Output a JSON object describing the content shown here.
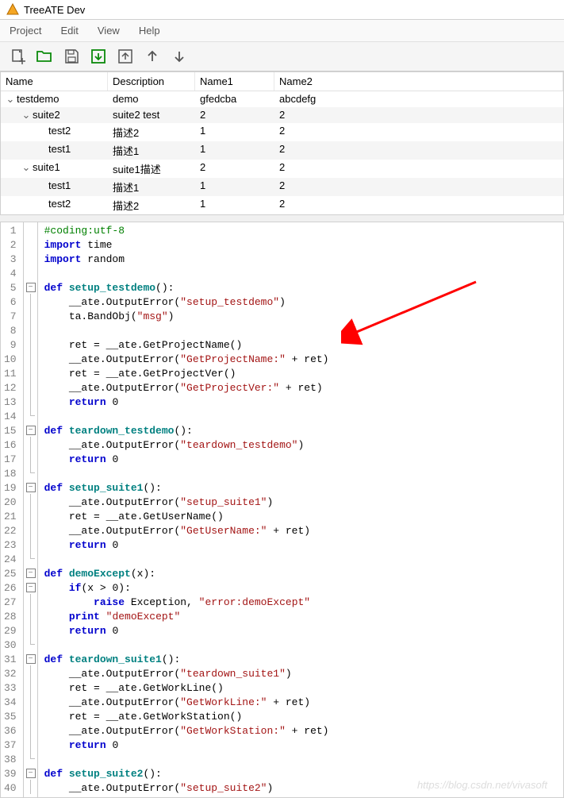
{
  "title": "TreeATE Dev",
  "menu": {
    "project": "Project",
    "edit": "Edit",
    "view": "View",
    "help": "Help"
  },
  "treeHeader": {
    "name": "Name",
    "desc": "Description",
    "n1": "Name1",
    "n2": "Name2"
  },
  "treeRows": [
    {
      "indent": 0,
      "exp": "⌄",
      "name": "testdemo",
      "desc": "demo",
      "n1": "gfedcba",
      "n2": "abcdefg"
    },
    {
      "indent": 1,
      "exp": "⌄",
      "name": "suite2",
      "desc": "suite2 test",
      "n1": "2",
      "n2": "2"
    },
    {
      "indent": 2,
      "exp": "",
      "name": "test2",
      "desc": "描述2",
      "n1": "1",
      "n2": "2"
    },
    {
      "indent": 2,
      "exp": "",
      "name": "test1",
      "desc": "描述1",
      "n1": "1",
      "n2": "2"
    },
    {
      "indent": 1,
      "exp": "⌄",
      "name": "suite1",
      "desc": "suite1描述",
      "n1": "2",
      "n2": "2"
    },
    {
      "indent": 2,
      "exp": "",
      "name": "test1",
      "desc": "描述1",
      "n1": "1",
      "n2": "2"
    },
    {
      "indent": 2,
      "exp": "",
      "name": "test2",
      "desc": "描述2",
      "n1": "1",
      "n2": "2"
    }
  ],
  "code": [
    {
      "n": 1,
      "f": "",
      "h": "<span class='cm'>#coding:utf-8</span>"
    },
    {
      "n": 2,
      "f": "",
      "h": "<span class='kw'>import</span> time"
    },
    {
      "n": 3,
      "f": "",
      "h": "<span class='kw'>import</span> random"
    },
    {
      "n": 4,
      "f": "",
      "h": ""
    },
    {
      "n": 5,
      "f": "minus",
      "h": "<span class='kw'>def</span> <span class='fn'>setup_testdemo</span>():"
    },
    {
      "n": 6,
      "f": "line",
      "h": "    __ate.OutputError(<span class='str'>\"setup_testdemo\"</span>)"
    },
    {
      "n": 7,
      "f": "line",
      "h": "    ta.BandObj(<span class='str'>\"msg\"</span>)"
    },
    {
      "n": 8,
      "f": "line",
      "h": ""
    },
    {
      "n": 9,
      "f": "line",
      "h": "    ret = __ate.GetProjectName()"
    },
    {
      "n": 10,
      "f": "line",
      "h": "    __ate.OutputError(<span class='str'>\"GetProjectName:\"</span> + ret)"
    },
    {
      "n": 11,
      "f": "line",
      "h": "    ret = __ate.GetProjectVer()"
    },
    {
      "n": 12,
      "f": "line",
      "h": "    __ate.OutputError(<span class='str'>\"GetProjectVer:\"</span> + ret)"
    },
    {
      "n": 13,
      "f": "line",
      "h": "    <span class='kw'>return</span> <span class='num'>0</span>"
    },
    {
      "n": 14,
      "f": "end",
      "h": ""
    },
    {
      "n": 15,
      "f": "minus",
      "h": "<span class='kw'>def</span> <span class='fn'>teardown_testdemo</span>():"
    },
    {
      "n": 16,
      "f": "line",
      "h": "    __ate.OutputError(<span class='str'>\"teardown_testdemo\"</span>)"
    },
    {
      "n": 17,
      "f": "line",
      "h": "    <span class='kw'>return</span> <span class='num'>0</span>"
    },
    {
      "n": 18,
      "f": "end",
      "h": ""
    },
    {
      "n": 19,
      "f": "minus",
      "h": "<span class='kw'>def</span> <span class='fn'>setup_suite1</span>():"
    },
    {
      "n": 20,
      "f": "line",
      "h": "    __ate.OutputError(<span class='str'>\"setup_suite1\"</span>)"
    },
    {
      "n": 21,
      "f": "line",
      "h": "    ret = __ate.GetUserName()"
    },
    {
      "n": 22,
      "f": "line",
      "h": "    __ate.OutputError(<span class='str'>\"GetUserName:\"</span> + ret)"
    },
    {
      "n": 23,
      "f": "line",
      "h": "    <span class='kw'>return</span> <span class='num'>0</span>"
    },
    {
      "n": 24,
      "f": "end",
      "h": ""
    },
    {
      "n": 25,
      "f": "minus",
      "h": "<span class='kw'>def</span> <span class='fn'>demoExcept</span>(x):"
    },
    {
      "n": 26,
      "f": "minus",
      "h": "    <span class='kw'>if</span>(x &gt; <span class='num'>0</span>):"
    },
    {
      "n": 27,
      "f": "line",
      "h": "        <span class='kw'>raise</span> Exception, <span class='str'>\"error:demoExcept\"</span>"
    },
    {
      "n": 28,
      "f": "line",
      "h": "    <span class='kw'>print</span> <span class='str'>\"demoExcept\"</span>"
    },
    {
      "n": 29,
      "f": "line",
      "h": "    <span class='kw'>return</span> <span class='num'>0</span>"
    },
    {
      "n": 30,
      "f": "end",
      "h": ""
    },
    {
      "n": 31,
      "f": "minus",
      "h": "<span class='kw'>def</span> <span class='fn'>teardown_suite1</span>():"
    },
    {
      "n": 32,
      "f": "line",
      "h": "    __ate.OutputError(<span class='str'>\"teardown_suite1\"</span>)"
    },
    {
      "n": 33,
      "f": "line",
      "h": "    ret = __ate.GetWorkLine()"
    },
    {
      "n": 34,
      "f": "line",
      "h": "    __ate.OutputError(<span class='str'>\"GetWorkLine:\"</span> + ret)"
    },
    {
      "n": 35,
      "f": "line",
      "h": "    ret = __ate.GetWorkStation()"
    },
    {
      "n": 36,
      "f": "line",
      "h": "    __ate.OutputError(<span class='str'>\"GetWorkStation:\"</span> + ret)"
    },
    {
      "n": 37,
      "f": "line",
      "h": "    <span class='kw'>return</span> <span class='num'>0</span>"
    },
    {
      "n": 38,
      "f": "end",
      "h": ""
    },
    {
      "n": 39,
      "f": "minus",
      "h": "<span class='kw'>def</span> <span class='fn'>setup_suite2</span>():"
    },
    {
      "n": 40,
      "f": "line",
      "h": "    __ate.OutputError(<span class='str'>\"setup_suite2\"</span>)"
    }
  ],
  "watermark": "https://blog.csdn.net/vivasoft"
}
